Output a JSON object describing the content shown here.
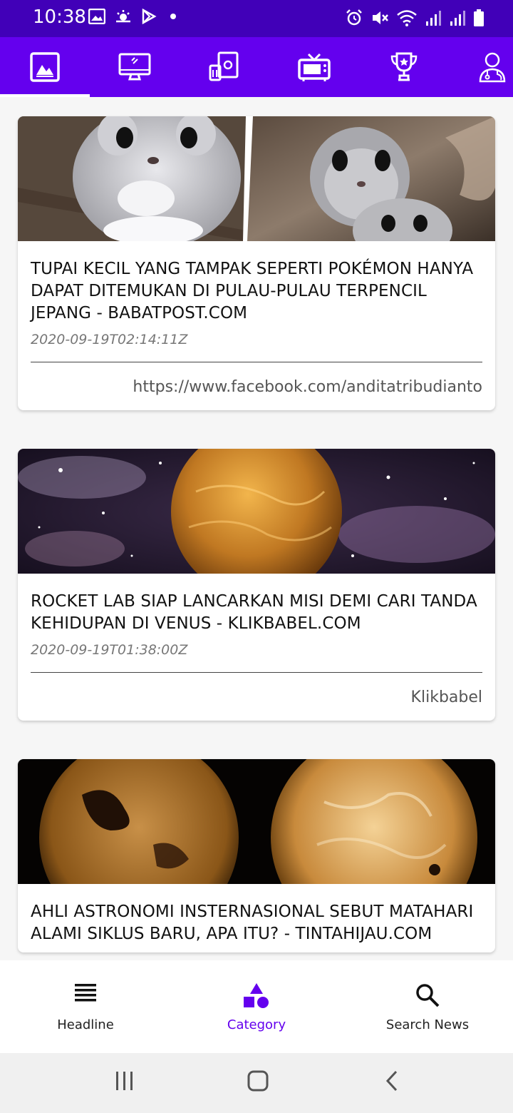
{
  "status_bar": {
    "time": "10:38",
    "left_icons": [
      "image-icon",
      "weather-icon",
      "play-store-icon",
      "dot-icon"
    ],
    "right_icons": [
      "alarm-icon",
      "mute-icon",
      "wifi-icon",
      "signal-icon",
      "signal-icon",
      "battery-icon"
    ]
  },
  "category_tabs": {
    "active_index": 0,
    "items": [
      {
        "icon": "image-icon"
      },
      {
        "icon": "monitor-icon"
      },
      {
        "icon": "money-icon"
      },
      {
        "icon": "tv-icon"
      },
      {
        "icon": "trophy-icon"
      },
      {
        "icon": "doctor-icon"
      }
    ]
  },
  "articles": [
    {
      "title": "TUPAI KECIL YANG TAMPAK SEPERTI POKÉMON HANYA DAPAT DITEMUKAN DI PULAU-PULAU TERPENCIL JEPANG - BABATPOST.COM",
      "date": "2020-09-19T02:14:11Z",
      "source": "https://www.facebook.com/anditatribudianto"
    },
    {
      "title": "ROCKET LAB SIAP LANCARKAN MISI DEMI CARI TANDA KEHIDUPAN DI VENUS - KLIKBABEL.COM",
      "date": "2020-09-19T01:38:00Z",
      "source": "Klikbabel"
    },
    {
      "title": "AHLI ASTRONOMI INSTERNASIONAL SEBUT MATAHARI ALAMI SIKLUS BARU, APA ITU? - TINTAHIJAU.COM",
      "date": "",
      "source": ""
    }
  ],
  "bottom_nav": {
    "active_index": 1,
    "items": [
      {
        "label": "Headline",
        "icon": "menu-icon"
      },
      {
        "label": "Category",
        "icon": "category-icon"
      },
      {
        "label": "Search News",
        "icon": "search-icon"
      }
    ]
  },
  "colors": {
    "status_bar": "#4100b8",
    "primary": "#6400ee",
    "background": "#f6f6f6"
  }
}
